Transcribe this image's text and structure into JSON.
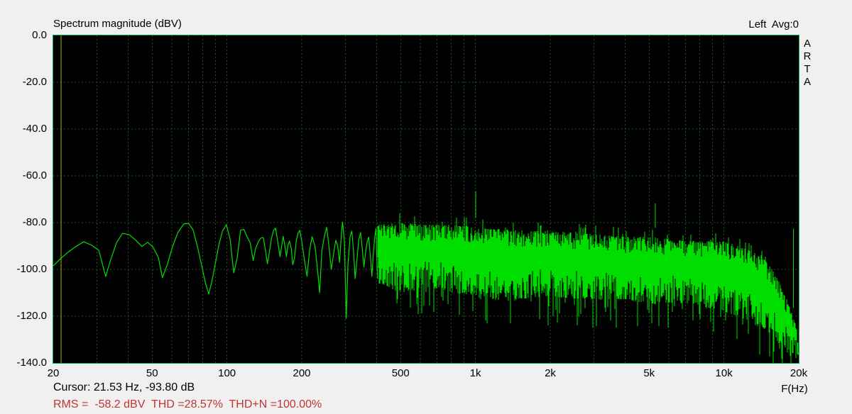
{
  "window": {
    "bg_color": "#f0f0f0"
  },
  "header": {
    "title": "Spectrum magnitude (dBV)",
    "channel_info": "Left  Avg:0"
  },
  "watermark": {
    "letters": [
      "A",
      "R",
      "T",
      "A"
    ]
  },
  "status": {
    "cursor_text": "Cursor: 21.53 Hz, -93.80 dB",
    "rms_text": "RMS =  -58.2 dBV  THD =28.57%  THD+N =100.00%",
    "rms_color": "#c03434"
  },
  "chart_data": {
    "type": "line",
    "title": "Spectrum magnitude (dBV)",
    "xlabel": "F(Hz)",
    "ylabel": "dBV",
    "x_scale": "log",
    "xlim": [
      20,
      20000
    ],
    "ylim": [
      -140,
      0
    ],
    "grid": true,
    "colors": {
      "plot_bg": "#000000",
      "border": "#00a64c",
      "grid": "#1d5a1d",
      "trace": "#00de00",
      "cursor_line": "#b0b000"
    },
    "y_ticks": {
      "values": [
        0,
        -20,
        -40,
        -60,
        -80,
        -100,
        -120,
        -140
      ],
      "labels": [
        "0.0",
        "-20.0",
        "-40.0",
        "-60.0",
        "-80.0",
        "-100.0",
        "-120.0",
        "-140.0"
      ]
    },
    "x_ticks": {
      "values": [
        20,
        50,
        100,
        200,
        500,
        1000,
        2000,
        5000,
        10000,
        20000
      ],
      "labels": [
        "20",
        "50",
        "100",
        "200",
        "500",
        "1k",
        "2k",
        "5k",
        "10k",
        "20k"
      ]
    },
    "grid_freqs": [
      30,
      40,
      50,
      60,
      70,
      80,
      90,
      100,
      200,
      300,
      400,
      500,
      600,
      700,
      800,
      900,
      1000,
      2000,
      3000,
      4000,
      5000,
      6000,
      7000,
      8000,
      9000,
      10000
    ],
    "grid_dbs": [
      -20,
      -40,
      -60,
      -80,
      -100,
      -120
    ],
    "cursor": {
      "freq_hz": 21.53,
      "db": -93.8
    },
    "series": {
      "name": "Left channel spectrum",
      "lf_points": [
        [
          20,
          -98.5
        ],
        [
          21.5,
          -95.2
        ],
        [
          23,
          -92.6
        ],
        [
          24.5,
          -90.4
        ],
        [
          26.5,
          -88.2
        ],
        [
          28.5,
          -89.6
        ],
        [
          30.5,
          -91.8
        ],
        [
          32.5,
          -103
        ],
        [
          34,
          -96
        ],
        [
          36,
          -88.5
        ],
        [
          38,
          -84.6
        ],
        [
          40.5,
          -85.2
        ],
        [
          43,
          -87.6
        ],
        [
          45.5,
          -90.2
        ],
        [
          48,
          -88.4
        ],
        [
          50.5,
          -90.6
        ],
        [
          53,
          -95
        ],
        [
          55,
          -103.5
        ],
        [
          57.5,
          -98
        ],
        [
          60.5,
          -90
        ],
        [
          63.5,
          -84.2
        ],
        [
          67,
          -80.6
        ],
        [
          70,
          -80.3
        ],
        [
          73,
          -83
        ],
        [
          76,
          -90
        ],
        [
          79,
          -98
        ],
        [
          82,
          -106
        ],
        [
          84.5,
          -110.5
        ],
        [
          87,
          -105
        ],
        [
          90,
          -97
        ],
        [
          93,
          -89
        ],
        [
          96,
          -83.6
        ],
        [
          99.5,
          -80.9
        ],
        [
          103,
          -87
        ],
        [
          106.5,
          -101.5
        ],
        [
          110,
          -95
        ],
        [
          113.5,
          -83.2
        ],
        [
          117,
          -82.9
        ],
        [
          120.5,
          -86
        ],
        [
          124,
          -88.6
        ],
        [
          127.5,
          -96.2
        ],
        [
          130.5,
          -91
        ],
        [
          134,
          -88
        ],
        [
          137,
          -86.6
        ],
        [
          140,
          -86.4
        ],
        [
          143,
          -92
        ],
        [
          145.5,
          -97.6
        ],
        [
          148,
          -93
        ],
        [
          151,
          -87
        ],
        [
          154,
          -83.2
        ],
        [
          157,
          -82.4
        ],
        [
          160,
          -88
        ],
        [
          163.5,
          -94.6
        ],
        [
          166,
          -90
        ],
        [
          168.5,
          -85.9
        ],
        [
          171,
          -90
        ],
        [
          173.5,
          -94.6
        ],
        [
          176,
          -89.6
        ],
        [
          178.5,
          -87.9
        ],
        [
          181.5,
          -91
        ],
        [
          184,
          -98
        ],
        [
          187,
          -95
        ],
        [
          190,
          -88
        ],
        [
          193,
          -84.6
        ],
        [
          196.5,
          -83.3
        ],
        [
          200,
          -88
        ],
        [
          205,
          -96
        ],
        [
          210,
          -103
        ],
        [
          215,
          -92
        ],
        [
          220,
          -86
        ],
        [
          226,
          -90
        ],
        [
          231,
          -99
        ],
        [
          236,
          -110
        ],
        [
          241,
          -92
        ],
        [
          247,
          -85.5
        ],
        [
          252,
          -82
        ],
        [
          258,
          -91
        ],
        [
          263,
          -100
        ],
        [
          268,
          -94
        ],
        [
          274,
          -87.5
        ],
        [
          279,
          -90
        ],
        [
          284,
          -97
        ],
        [
          289,
          -84
        ],
        [
          292,
          -79.8
        ],
        [
          297,
          -88
        ],
        [
          302,
          -121
        ],
        [
          307,
          -98
        ],
        [
          313,
          -86
        ],
        [
          318,
          -83.6
        ],
        [
          323,
          -92
        ],
        [
          328,
          -104
        ],
        [
          334,
          -95
        ],
        [
          339,
          -87.5
        ],
        [
          345,
          -84.2
        ],
        [
          350,
          -91
        ],
        [
          356,
          -99
        ],
        [
          361,
          -93
        ],
        [
          367,
          -88
        ],
        [
          372,
          -86.2
        ],
        [
          378,
          -95
        ],
        [
          383,
          -103
        ],
        [
          389,
          -92
        ],
        [
          394,
          -85.5
        ],
        [
          398,
          -82.6
        ],
        [
          401,
          -95
        ],
        [
          404,
          -104
        ]
      ],
      "noise_envelope": [
        [
          404,
          -81,
          -106
        ],
        [
          500,
          -80,
          -110
        ],
        [
          650,
          -81,
          -108
        ],
        [
          800,
          -81,
          -110
        ],
        [
          1000,
          -82,
          -111
        ],
        [
          1300,
          -83,
          -114
        ],
        [
          1700,
          -83.5,
          -112
        ],
        [
          2200,
          -84,
          -112
        ],
        [
          3000,
          -85,
          -113
        ],
        [
          4000,
          -86,
          -113
        ],
        [
          5000,
          -86,
          -115
        ],
        [
          6500,
          -87.5,
          -114
        ],
        [
          8000,
          -88,
          -116
        ],
        [
          10000,
          -88,
          -118
        ],
        [
          12000,
          -91,
          -121
        ],
        [
          14000,
          -94,
          -124
        ],
        [
          15500,
          -99,
          -128
        ],
        [
          16500,
          -104,
          -131
        ],
        [
          17500,
          -111,
          -134
        ],
        [
          18500,
          -117,
          -137
        ],
        [
          19300,
          -122,
          -139
        ],
        [
          19800,
          -128,
          -140
        ],
        [
          20000,
          -133,
          -140
        ]
      ],
      "spikes": [
        [
          1002,
          -66.5
        ],
        [
          5295,
          -71.8
        ],
        [
          19050,
          -82.5
        ]
      ]
    }
  }
}
